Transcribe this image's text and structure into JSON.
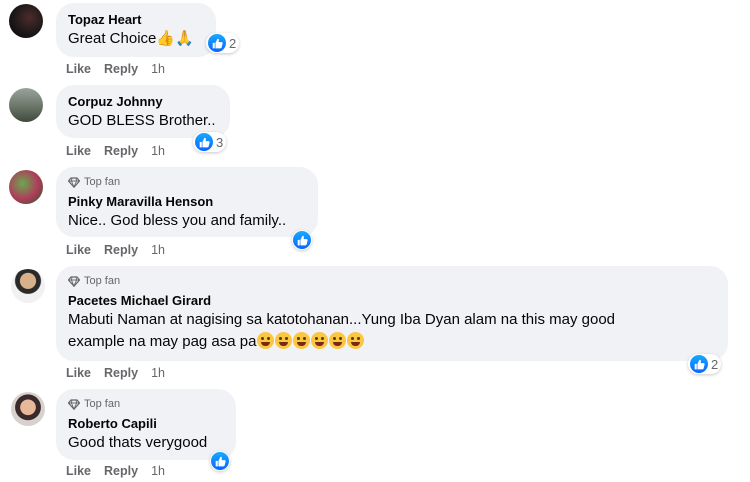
{
  "actions": {
    "like": "Like",
    "reply": "Reply"
  },
  "comments": [
    {
      "name": "Topaz Heart",
      "text": "Great Choice",
      "time": "1h",
      "reactions": "2",
      "top_fan": false
    },
    {
      "name": "Corpuz Johnny",
      "text": "GOD BLESS Brother..",
      "time": "1h",
      "reactions": "3",
      "top_fan": false
    },
    {
      "badge": "Top fan",
      "name": "Pinky Maravilla Henson",
      "text": "Nice.. God bless you and family..",
      "time": "1h",
      "reactions": "",
      "top_fan": true
    },
    {
      "badge": "Top fan",
      "name": "Pacetes Michael Girard",
      "text_line1": "Mabuti Naman at nagising sa katotohanan...Yung Iba Dyan alam na this may good",
      "text_line2": "example na may pag asa pa",
      "time": "1h",
      "reactions": "2",
      "top_fan": true
    },
    {
      "badge": "Top fan",
      "name": "Roberto Capili",
      "text": "Good thats verygood",
      "time": "1h",
      "reactions": "",
      "top_fan": true
    }
  ],
  "icons": {
    "thumbs_up_emoji": "👍",
    "pray_emoji": "🙏",
    "like_reaction": "like-icon",
    "diamond": "diamond-icon"
  },
  "colors": {
    "bubble": "#f0f2f5",
    "like_blue": "#0866ff",
    "meta_gray": "#65676b"
  }
}
